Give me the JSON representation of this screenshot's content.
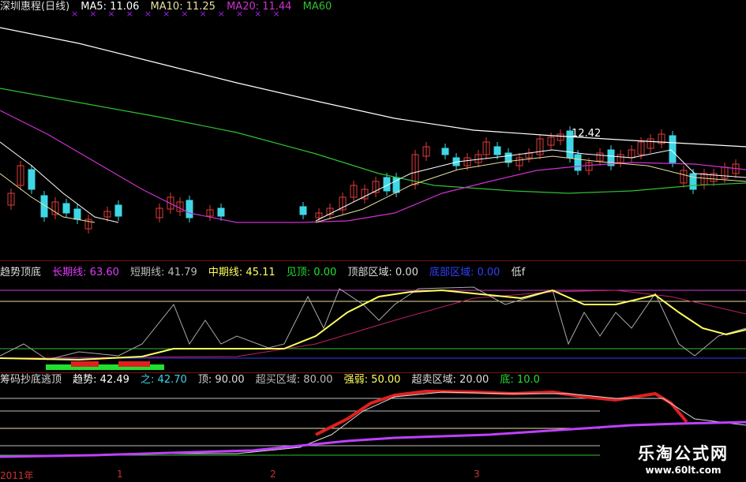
{
  "main_legend": {
    "stock": "深圳惠程(日线)",
    "ma5": "MA5: 11.06",
    "ma10": "MA10: 11.25",
    "ma20": "MA20: 11.44",
    "ma60": "MA60"
  },
  "main_annotation": "12.42",
  "ind1_legend": {
    "name": "趋势顶底",
    "long": "长期线: 63.60",
    "short": "短期线: 41.79",
    "mid": "中期线: 45.11",
    "top": "见顶: 0.00",
    "top_zone": "顶部区域: 0.00",
    "bottom_zone": "底部区域: 0.00",
    "low": "低f"
  },
  "ind2_legend": {
    "name": "筹码抄底逃顶",
    "trend": "趋势: 42.49",
    "zhi": "之: 42.70",
    "ding": "顶: 90.00",
    "overbuy": "超买区域: 80.00",
    "strength": "强弱: 50.00",
    "oversell": "超卖区域: 20.00",
    "di": "底: 10.0"
  },
  "axis": {
    "year": "2011年",
    "m1": "1",
    "m2": "2",
    "m3": "3"
  },
  "watermark": {
    "name": "乐淘公式网",
    "url": "www.60lt.com"
  },
  "colors": {
    "up": "#e23b3b",
    "down": "#3fd7e6",
    "ma5": "#ffffff",
    "ma10": "#e8e0a0",
    "ma20": "#d030d0",
    "ma60": "#30c030",
    "yellow": "#ffff60",
    "grey": "#aaaaaa",
    "red": "#e02020",
    "purple": "#c040ff",
    "green": "#20e030",
    "blue": "#3040ff"
  }
}
